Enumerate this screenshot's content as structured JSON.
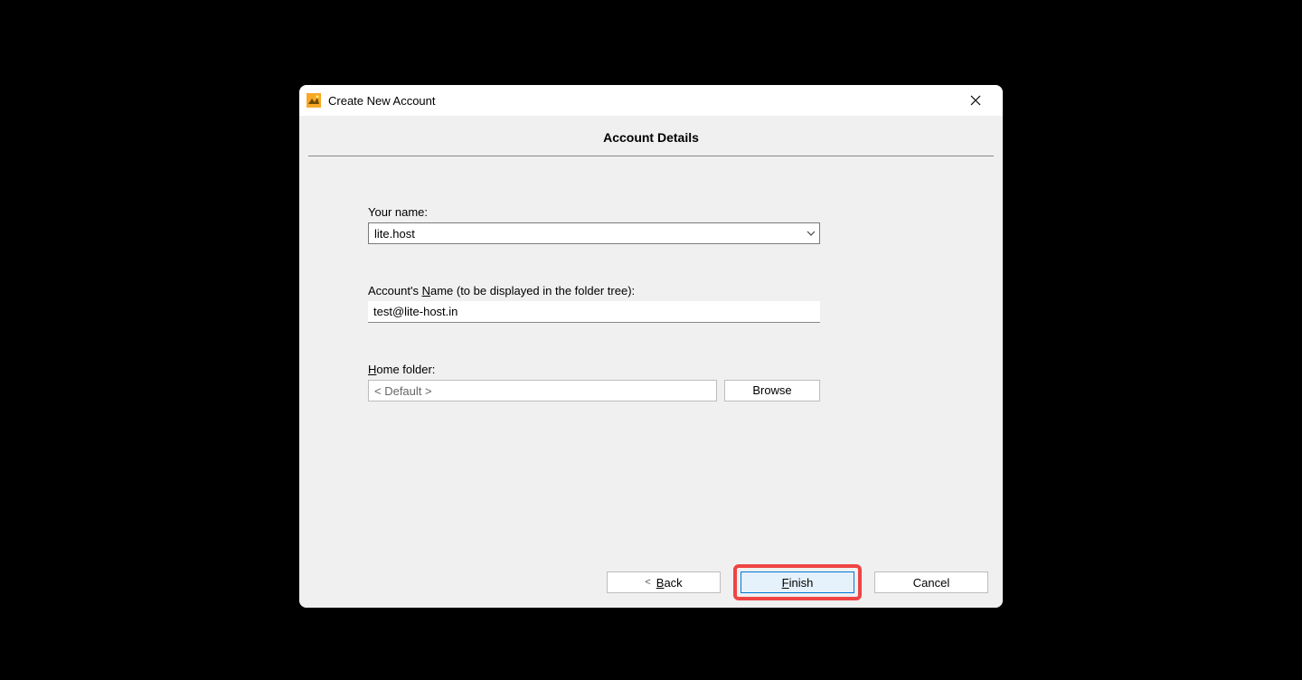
{
  "dialog": {
    "title": "Create New Account",
    "section_title": "Account Details"
  },
  "form": {
    "your_name_label": "Your name:",
    "your_name_value": "lite.host",
    "account_name_label_prefix": "Account's ",
    "account_name_label_underlined": "N",
    "account_name_label_suffix": "ame (to be displayed in the folder tree):",
    "account_name_value": "test@lite-host.in",
    "home_folder_label_underlined": "H",
    "home_folder_label_rest": "ome folder:",
    "home_folder_value": "< Default >",
    "browse_label": "Browse"
  },
  "footer": {
    "back_label": "Back",
    "finish_label": "Finish",
    "cancel_label": "Cancel"
  }
}
